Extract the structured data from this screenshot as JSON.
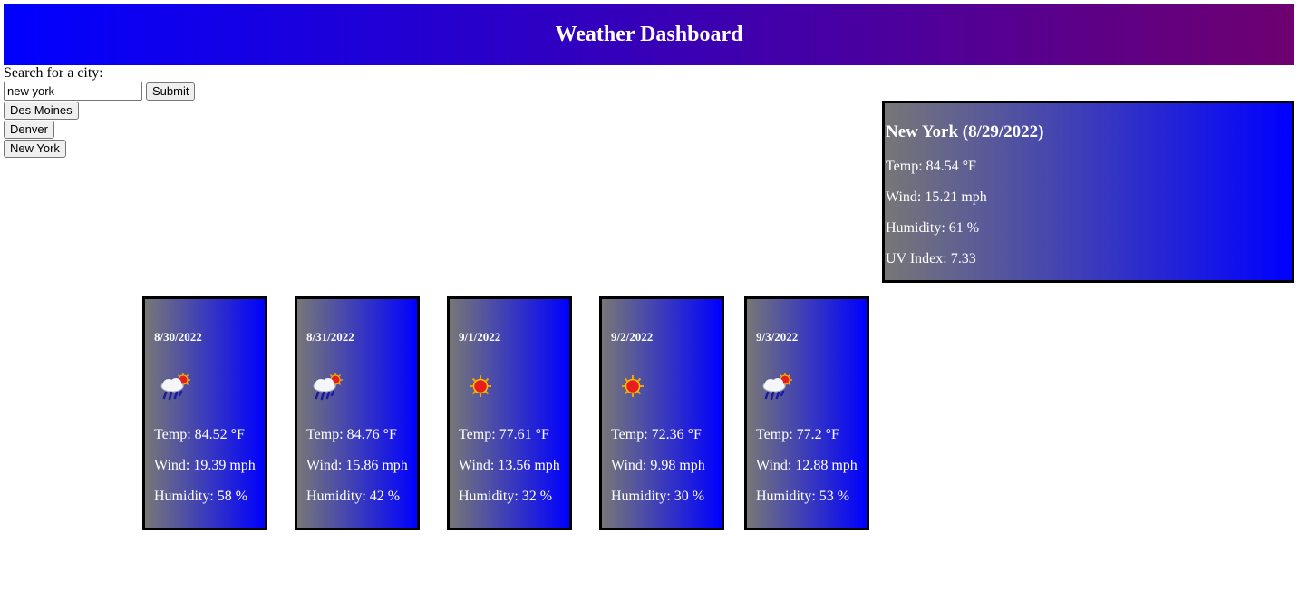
{
  "header": {
    "title": "Weather Dashboard"
  },
  "search": {
    "label": "Search for a city:",
    "value": "new york",
    "submit_label": "Submit"
  },
  "history": [
    "Des Moines",
    "Denver",
    "New York"
  ],
  "current": {
    "title": "New York (8/29/2022)",
    "temp": "Temp: 84.54 °F",
    "wind": "Wind: 15.21 mph",
    "humidity": "Humidity: 61 %",
    "uv": "UV Index: 7.33"
  },
  "forecast": [
    {
      "date": "8/30/2022",
      "icon": "rain-sun-icon",
      "temp": "Temp: 84.52 °F",
      "wind": "Wind: 19.39 mph",
      "humidity": "Humidity: 58 %"
    },
    {
      "date": "8/31/2022",
      "icon": "rain-sun-icon",
      "temp": "Temp: 84.76 °F",
      "wind": "Wind: 15.86 mph",
      "humidity": "Humidity: 42 %"
    },
    {
      "date": "9/1/2022",
      "icon": "sun-icon",
      "temp": "Temp: 77.61 °F",
      "wind": "Wind: 13.56 mph",
      "humidity": "Humidity: 32 %"
    },
    {
      "date": "9/2/2022",
      "icon": "sun-icon",
      "temp": "Temp: 72.36 °F",
      "wind": "Wind: 9.98 mph",
      "humidity": "Humidity: 30 %"
    },
    {
      "date": "9/3/2022",
      "icon": "rain-sun-icon",
      "temp": "Temp: 77.2 °F",
      "wind": "Wind: 12.88 mph",
      "humidity": "Humidity: 53 %"
    }
  ],
  "colors": {
    "header_start": "#0000ff",
    "header_end": "#6e0070",
    "card_start": "#777777",
    "card_end": "#0000ff"
  }
}
